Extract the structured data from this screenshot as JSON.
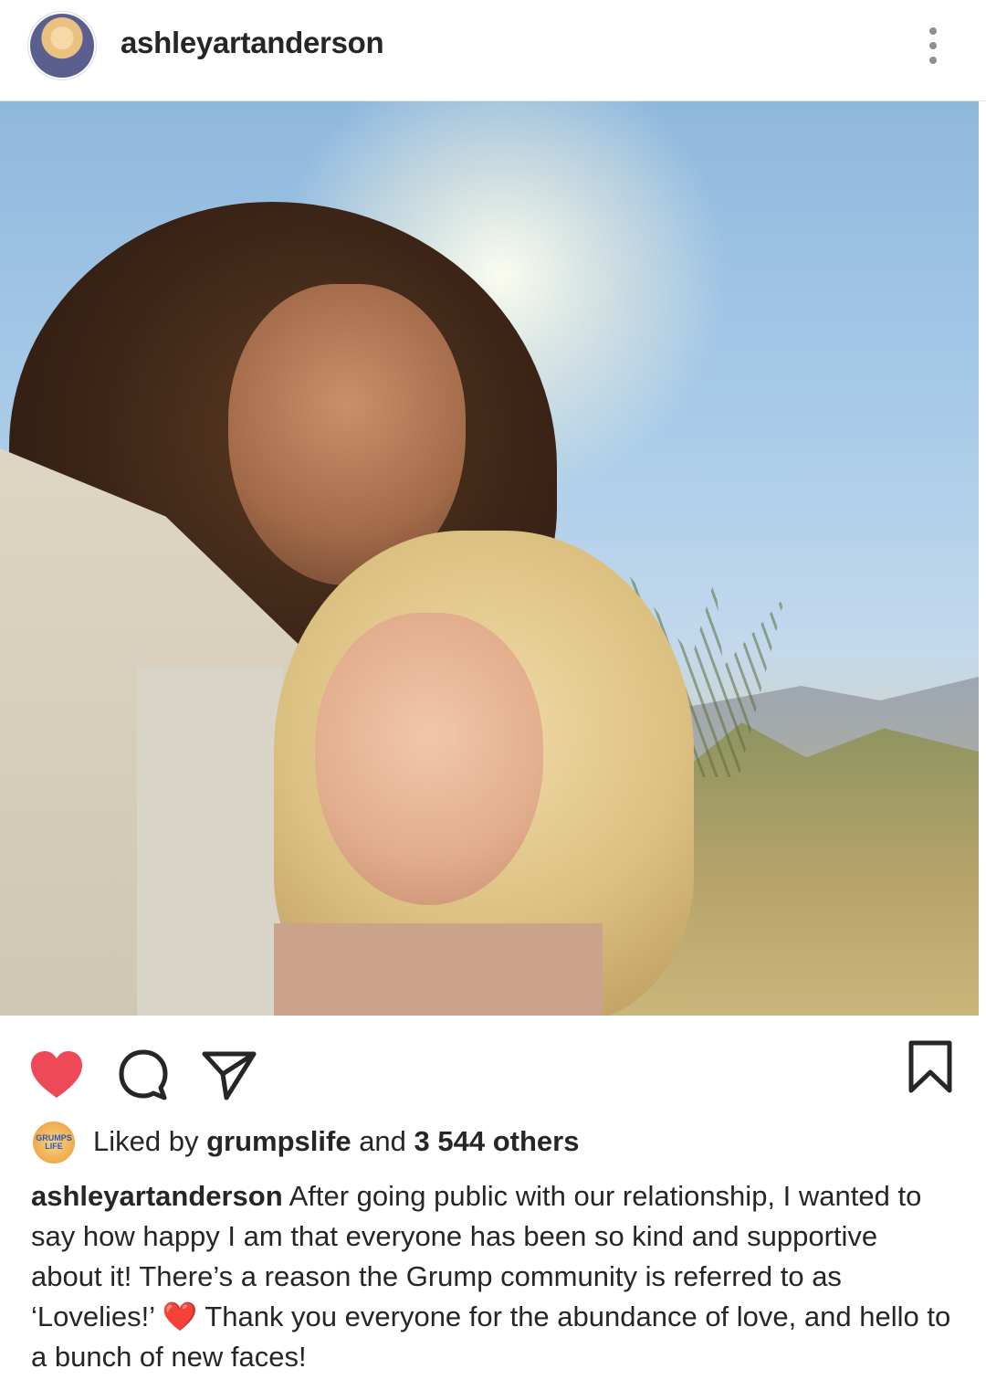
{
  "header": {
    "username": "ashleyartanderson",
    "avatar_icon": "profile-avatar",
    "more_icon": "more-vertical-icon"
  },
  "post": {
    "image_description_icon": "photo"
  },
  "actions": {
    "like_icon": "heart-filled-icon",
    "comment_icon": "comment-icon",
    "share_icon": "send-icon",
    "save_icon": "bookmark-icon",
    "like_color": "#ed4956"
  },
  "likes": {
    "prefix": "Liked by",
    "liker": "grumpslife",
    "middle": "and",
    "count_text": "3 544 others",
    "liker_avatar_text": "GRUMPS LIFE"
  },
  "caption": {
    "username": "ashleyartanderson",
    "text_before_emoji": "After going public with our relationship, I wanted to say how happy I am that everyone has been so kind and supportive about it! There’s a reason the Grump community is referred to as ‘Lovelies!’",
    "emoji": "❤️",
    "text_after_emoji": "Thank you everyone for the abundance of love, and hello to a bunch of new faces!"
  }
}
